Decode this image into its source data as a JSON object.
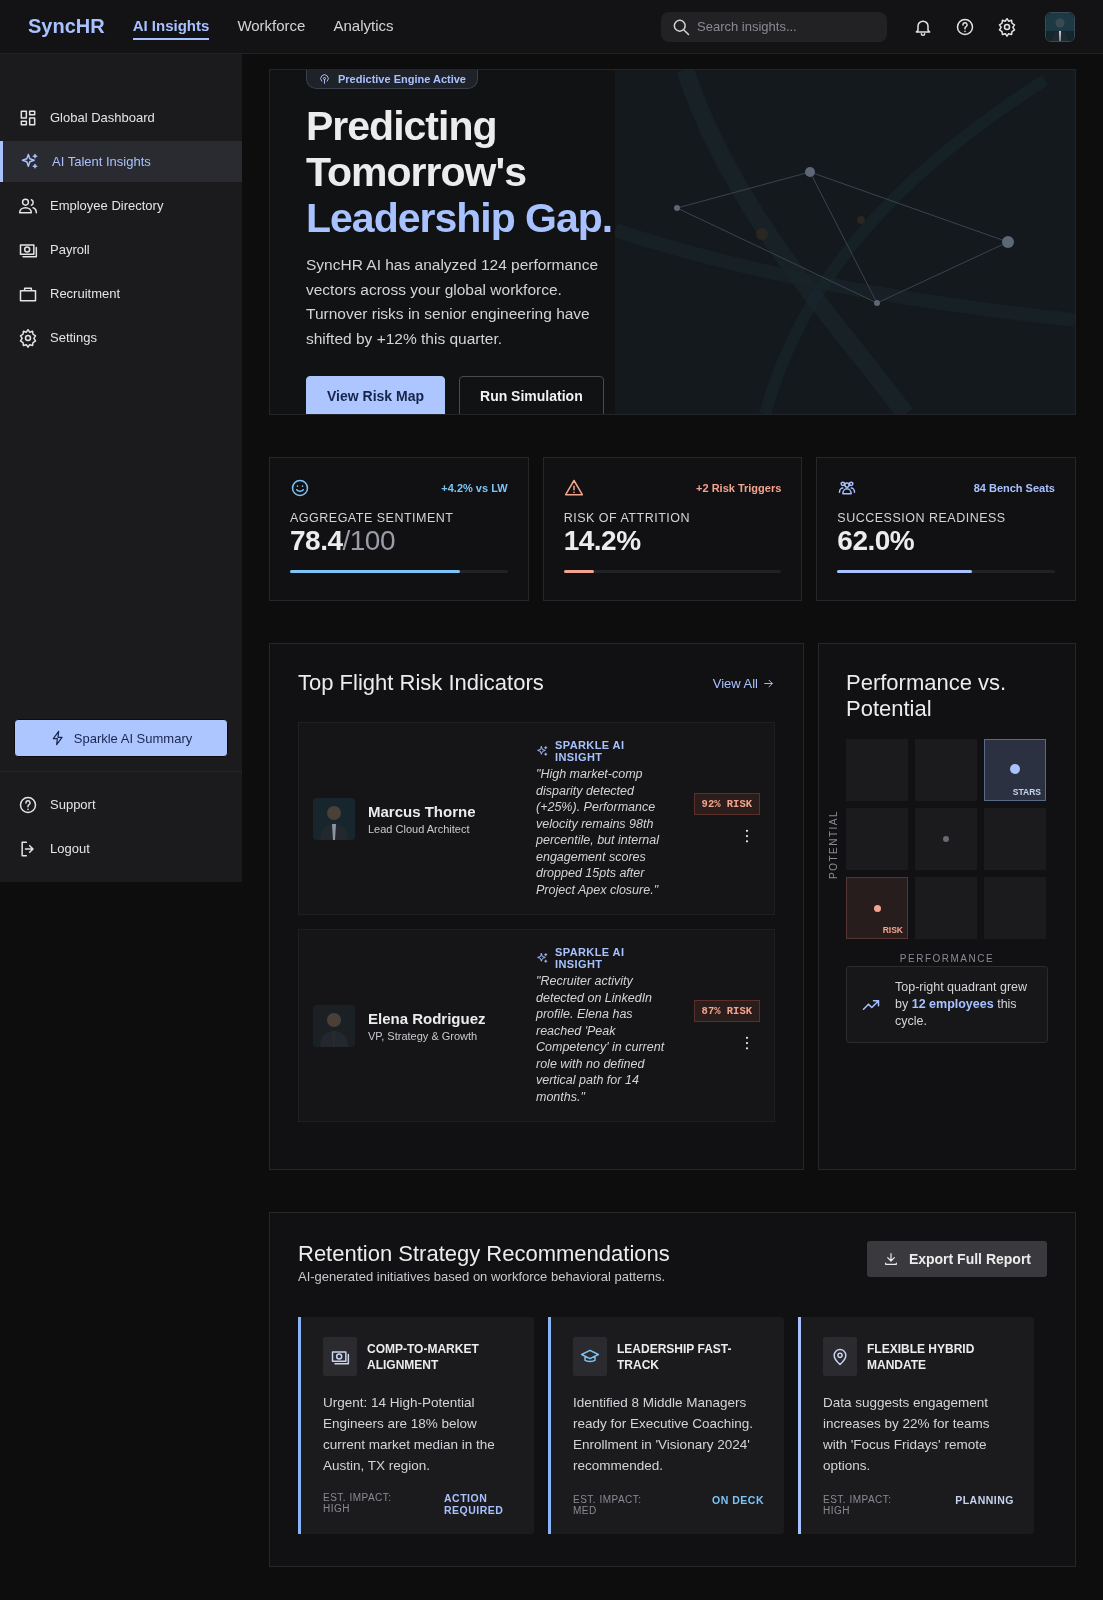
{
  "topbar": {
    "brand": "SyncHR",
    "links": [
      {
        "label": "AI Insights",
        "selected": true
      },
      {
        "label": "Workforce",
        "selected": false
      },
      {
        "label": "Analytics",
        "selected": false
      }
    ],
    "search": {
      "placeholder": "Search insights..."
    }
  },
  "sidebar": {
    "items": [
      {
        "label": "Global Dashboard",
        "selected": false
      },
      {
        "label": "AI Talent Insights",
        "selected": true
      },
      {
        "label": "Employee Directory",
        "selected": false
      },
      {
        "label": "Payroll",
        "selected": false
      },
      {
        "label": "Recruitment",
        "selected": false
      },
      {
        "label": "Settings",
        "selected": false
      }
    ],
    "action_button": "Sparkle AI Summary",
    "footer_items": [
      "Support",
      "Logout"
    ]
  },
  "hero": {
    "badge": "Predictive Engine Active",
    "title_lines": [
      "Predicting",
      "Tomorrow's"
    ],
    "title_highlight": "Leadership Gap.",
    "body": "SyncHR AI has analyzed 124 performance vectors across your global workforce. Turnover risks in senior engineering have shifted by +12% this quarter.",
    "buttons": [
      {
        "label": "View Risk Map",
        "kind": "primary"
      },
      {
        "label": "Run Simulation",
        "kind": "secondary"
      }
    ]
  },
  "stats": [
    {
      "delta": "+4.2% vs LW",
      "label": "AGGREGATE SENTIMENT",
      "value": "78.4",
      "denominator": "/100",
      "level": 0.78,
      "color": "#7cc4f5"
    },
    {
      "delta": "+2 Risk Triggers",
      "label": "RISK OF ATTRITION",
      "value": "14.2%",
      "level": 0.14,
      "color": "#f4a48e"
    },
    {
      "delta": "84 Bench Seats",
      "label": "SUCCESSION READINESS",
      "value": "62.0%",
      "level": 0.62,
      "color": "#a8c1ff"
    }
  ],
  "flight_risk": {
    "title": "Top Flight Risk Indicators",
    "link": "View All",
    "rows": [
      {
        "name": "Marcus Thorne",
        "role": "Lead Cloud Architect",
        "insight_label": "SPARKLE AI INSIGHT",
        "insight": "\"High market-comp disparity detected (+25%). Performance velocity remains 98th percentile, but internal engagement scores dropped 15pts after Project Apex closure.\"",
        "risk": "92% RISK"
      },
      {
        "name": "Elena Rodriguez",
        "role": "VP, Strategy & Growth",
        "insight_label": "SPARKLE AI INSIGHT",
        "insight": "\"Recruiter activity detected on LinkedIn profile. Elena has reached 'Peak Competency' in current role with no defined vertical path for 14 months.\"",
        "risk": "87% RISK"
      }
    ]
  },
  "matrix": {
    "title": "Performance vs. Potential",
    "y_label": "POTENTIAL",
    "x_label": "PERFORMANCE",
    "cells": [
      {
        "kind": "empty"
      },
      {
        "kind": "empty"
      },
      {
        "kind": "stars",
        "label": "STARS"
      },
      {
        "kind": "empty"
      },
      {
        "kind": "neutral"
      },
      {
        "kind": "empty"
      },
      {
        "kind": "risk",
        "label": "RISK"
      },
      {
        "kind": "empty"
      },
      {
        "kind": "empty"
      }
    ],
    "callout": "Top-right quadrant grew by **12 employees** this cycle."
  },
  "retention": {
    "title": "Retention Strategy Recommendations",
    "subtitle": "AI-generated initiatives based on workforce behavioral patterns.",
    "export_button": "Export Full Report",
    "cards": [
      {
        "title": "COMP-TO-MARKET ALIGNMENT",
        "body": "Urgent: 14 High-Potential Engineers are 18% below current market median in the Austin, TX region.",
        "impact": "EST. IMPACT: HIGH",
        "status": "ACTION REQUIRED",
        "color": "#a8c1ff"
      },
      {
        "title": "LEADERSHIP FAST-TRACK",
        "body": "Identified 8 Middle Managers ready for Executive Coaching. Enrollment in 'Visionary 2024' recommended.",
        "impact": "EST. IMPACT: MED",
        "status": "ON DECK",
        "color": "#7cc4f5"
      },
      {
        "title": "FLEXIBLE HYBRID MANDATE",
        "body": "Data suggests engagement increases by 22% for teams with 'Focus Fridays' remote options.",
        "impact": "EST. IMPACT: HIGH",
        "status": "PLANNING",
        "color": "#c8d3f0"
      }
    ]
  }
}
